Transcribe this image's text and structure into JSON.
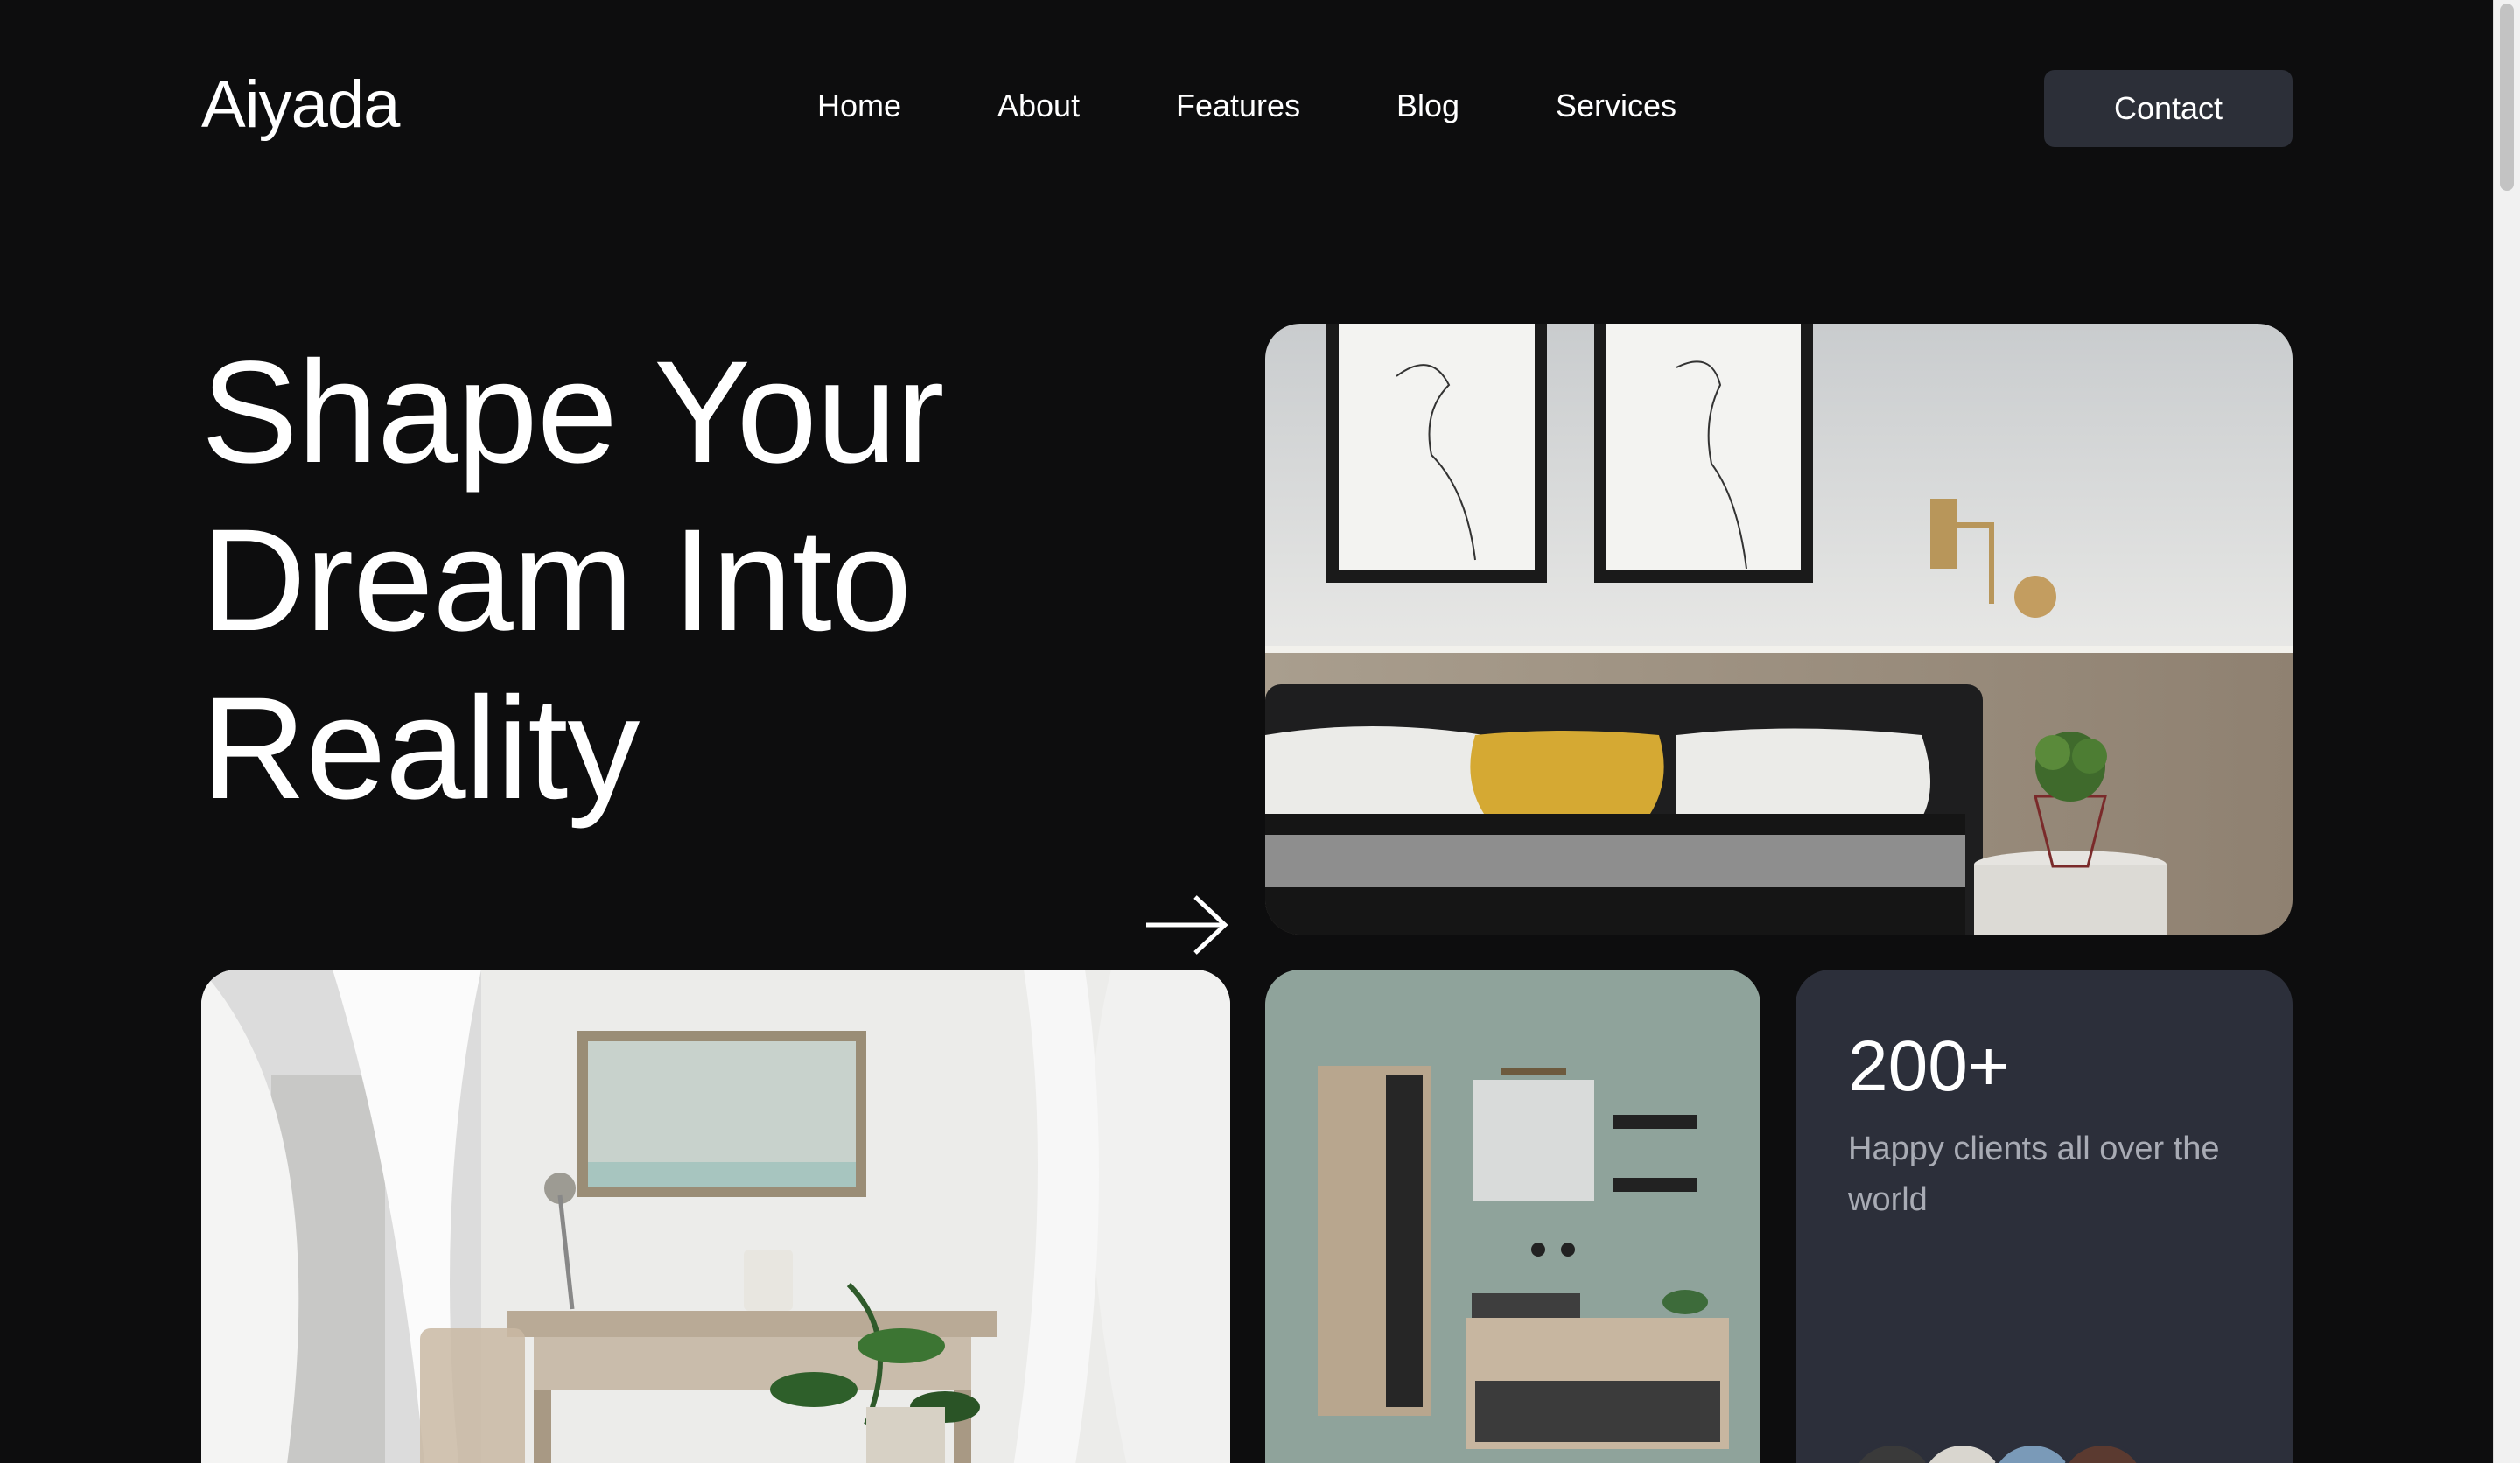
{
  "brand": {
    "name": "Aiyada"
  },
  "nav": {
    "items": [
      {
        "label": "Home"
      },
      {
        "label": "About"
      },
      {
        "label": "Features"
      },
      {
        "label": "Blog"
      },
      {
        "label": "Services"
      }
    ],
    "contact_label": "Contact"
  },
  "hero": {
    "lines": [
      "Shape Your",
      "Dream Into",
      "Reality"
    ],
    "arrow_icon": "arrow-right-icon"
  },
  "stats": {
    "number": "200+",
    "text": "Happy clients all over the world"
  },
  "images": {
    "bedroom": "bedroom-photo",
    "desk": "desk-room-photo",
    "bathroom": "bathroom-photo",
    "avatars": [
      "avatar-1",
      "avatar-2",
      "avatar-3",
      "avatar-4"
    ]
  },
  "colors": {
    "background": "#0d0d0e",
    "button": "#2c2f38",
    "stat_card": "#2c2f3a",
    "text": "#ffffff",
    "muted_text": "#a8abb4"
  }
}
